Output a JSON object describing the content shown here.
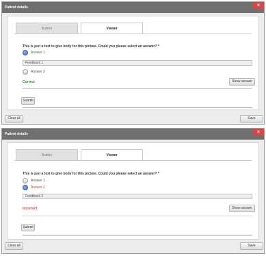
{
  "dialogs": [
    {
      "title": "Patient details",
      "close_glyph": "×",
      "tabs": [
        {
          "label": "Builder"
        },
        {
          "label": "Viewer"
        }
      ],
      "question": "This is just a text to give body for this picture. Could you please select an answer? *",
      "answers": [
        {
          "label": "Answer 1",
          "checked": true
        },
        {
          "label": "Answer 2",
          "checked": false
        }
      ],
      "feedback": "Feedback 1",
      "status": "Correct",
      "show_answer_label": "Show answer",
      "submit_label": "Submit",
      "clear_all_label": "Clear all",
      "save_label": "Save"
    },
    {
      "title": "Patient details",
      "close_glyph": "×",
      "tabs": [
        {
          "label": "Builder"
        },
        {
          "label": "Viewer"
        }
      ],
      "question": "This is just a text to give body for this picture. Could you please select an answer? *",
      "answers": [
        {
          "label": "Answer 1",
          "checked": false
        },
        {
          "label": "Answer 2",
          "checked": true
        }
      ],
      "feedback": "Feedback 2",
      "status": "Incorrect",
      "show_answer_label": "Show answer",
      "submit_label": "Submit",
      "clear_all_label": "Clear all",
      "save_label": "Save"
    }
  ],
  "colors": {
    "titlebar": "#707070",
    "close": "#d84646",
    "correct": "#2f8a25",
    "incorrect": "#d43f3f",
    "radio_selected": "#3f6fc2"
  }
}
